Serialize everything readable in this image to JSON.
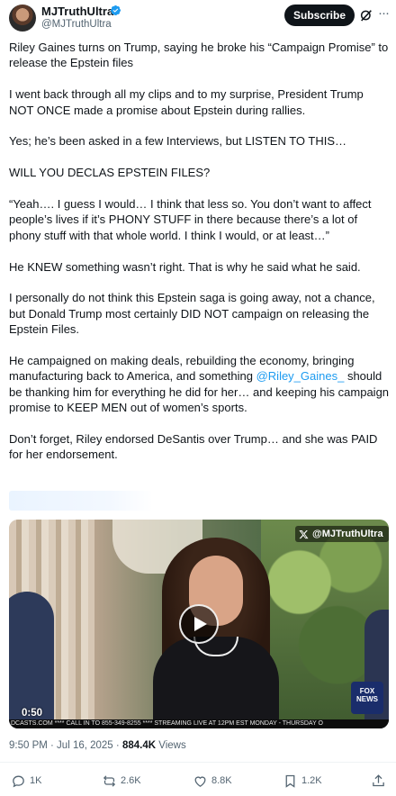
{
  "author": {
    "display_name": "MJTruthUltra",
    "handle": "@MJTruthUltra",
    "verified_icon": "verified-badge-icon",
    "verified_color": "#1d9bf0"
  },
  "header": {
    "subscribe_label": "Subscribe",
    "grok_icon": "grok-icon",
    "more_icon": "more-options-icon",
    "more_glyph": "···"
  },
  "post": {
    "p1": "Riley Gaines turns on Trump, saying he broke his “Campaign Promise” to release the Epstein files",
    "p2": "I went back through all my clips and to my surprise, President Trump NOT ONCE made a promise about Epstein during rallies.",
    "p3": "Yes; he’s been asked in a few Interviews, but LISTEN TO THIS…",
    "p4": "WILL YOU DECLAS EPSTEIN FILES?",
    "p5": "“Yeah…. I guess I would… I think that less so. You don’t want to affect people’s lives if it’s PHONY STUFF in there because there’s a lot of phony stuff with that whole world. I think I would, or at least…”",
    "p6": "He KNEW something wasn’t right. That is why he said what he said.",
    "p7": "I personally do not think this Epstein saga is going away, not a chance, but Donald Trump most certainly DID NOT campaign on releasing the Epstein Files.",
    "p8_before": "He campaigned on making deals, rebuilding the economy, bringing manufacturing back to America, and something ",
    "p8_mention": "@Riley_Gaines_",
    "p8_after": " should be thanking him for everything he did for her… and keeping his campaign promise to KEEP MEN out of women’s sports.",
    "p9": "Don’t forget, Riley endorsed DeSantis over Trump… and she was PAID for her endorsement."
  },
  "video": {
    "watermark": "@MJTruthUltra",
    "watermark_icon": "x-logo-icon",
    "duration": "0:50",
    "play_icon": "play-icon",
    "network_logo": "FOX NEWS",
    "ticker": "DCASTS.COM   ****   CALL IN TO 855-349-8255   ****   STREAMING LIVE AT 12PM EST MONDAY - THURSDAY O"
  },
  "meta": {
    "time": "9:50 PM · Jul 16, 2025 · ",
    "views_count": "884.4K",
    "views_label": " Views"
  },
  "actions": {
    "replies": "1K",
    "reposts": "2.6K",
    "likes": "8.8K",
    "bookmarks": "1.2K"
  }
}
